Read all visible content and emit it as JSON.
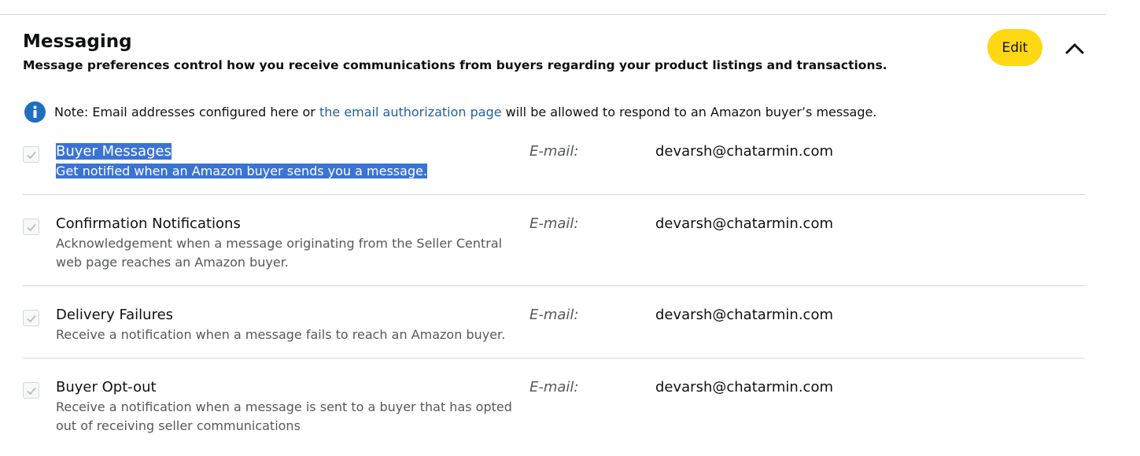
{
  "section": {
    "title": "Messaging",
    "subtitle": "Message preferences control how you receive communications from buyers regarding your product listings and transactions.",
    "edit_label": "Edit",
    "toggle_icon": "chevron-up-icon"
  },
  "note": {
    "icon": "info-icon",
    "prefix": "Note: Email addresses configured here or ",
    "link_text": "the email authorization page",
    "suffix": " will be allowed to respond to an Amazon buyer’s message."
  },
  "preferences": [
    {
      "title": "Buyer Messages",
      "description": "Get notified when an Amazon buyer sends you a message.",
      "email_label": "E-mail:",
      "email": "devarsh@chatarmin.com",
      "checked": true,
      "selected": true
    },
    {
      "title": "Confirmation Notifications",
      "description": "Acknowledgement when a message originating from the Seller Central web page reaches an Amazon buyer.",
      "email_label": "E-mail:",
      "email": "devarsh@chatarmin.com",
      "checked": true,
      "selected": false
    },
    {
      "title": "Delivery Failures",
      "description": "Receive a notification when a message fails to reach an Amazon buyer.",
      "email_label": "E-mail:",
      "email": "devarsh@chatarmin.com",
      "checked": true,
      "selected": false
    },
    {
      "title": "Buyer Opt-out",
      "description": "Receive a notification when a message is sent to a buyer that has opted out of receiving seller communications",
      "email_label": "E-mail:",
      "email": "devarsh@chatarmin.com",
      "checked": true,
      "selected": false
    }
  ],
  "colors": {
    "edit_button": "#ffd814",
    "link": "#2162a1",
    "info_icon": "#1e6fbf",
    "selection_highlight": "#3a73d4"
  }
}
